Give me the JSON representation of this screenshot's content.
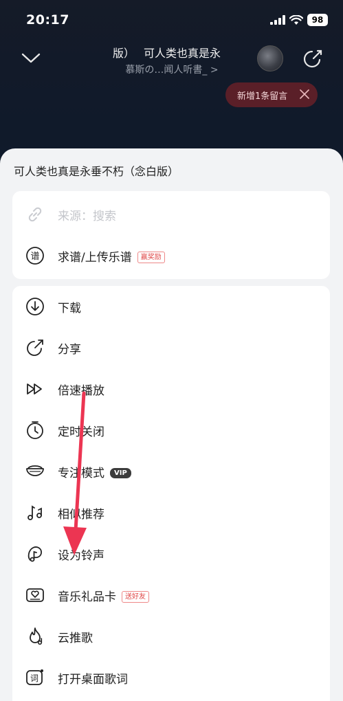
{
  "status_bar": {
    "time": "20:17",
    "battery": "98"
  },
  "player": {
    "song_title": "版）　 可人类也真是永",
    "artist": "慕斯の…闻人听書_ >",
    "toast": "新增1条留言"
  },
  "sheet": {
    "title": "可人类也真是永垂不朽（念白版）",
    "source_row": {
      "label": "来源：搜索",
      "icon": "link-icon"
    },
    "score_row": {
      "label": "求谱/上传乐谱",
      "badge": "赢奖励",
      "icon": "score-icon"
    },
    "menu_items": [
      {
        "label": "下载",
        "icon": "download-icon"
      },
      {
        "label": "分享",
        "icon": "share-icon"
      },
      {
        "label": "倍速播放",
        "icon": "speed-icon"
      },
      {
        "label": "定时关闭",
        "icon": "timer-icon"
      },
      {
        "label": "专注模式",
        "icon": "focus-icon",
        "vip": "VIP"
      },
      {
        "label": "相似推荐",
        "icon": "music-notes-icon"
      },
      {
        "label": "设为铃声",
        "icon": "ringtone-icon"
      },
      {
        "label": "音乐礼品卡",
        "icon": "gift-card-icon",
        "badge": "送好友"
      },
      {
        "label": "云推歌",
        "icon": "cloud-recommend-icon"
      },
      {
        "label": "打开桌面歌词",
        "icon": "desktop-lyrics-icon"
      }
    ]
  },
  "colors": {
    "accent_red": "#e8344e",
    "sheet_bg": "#f2f3f5",
    "toast_bg": "#5a1f28"
  }
}
